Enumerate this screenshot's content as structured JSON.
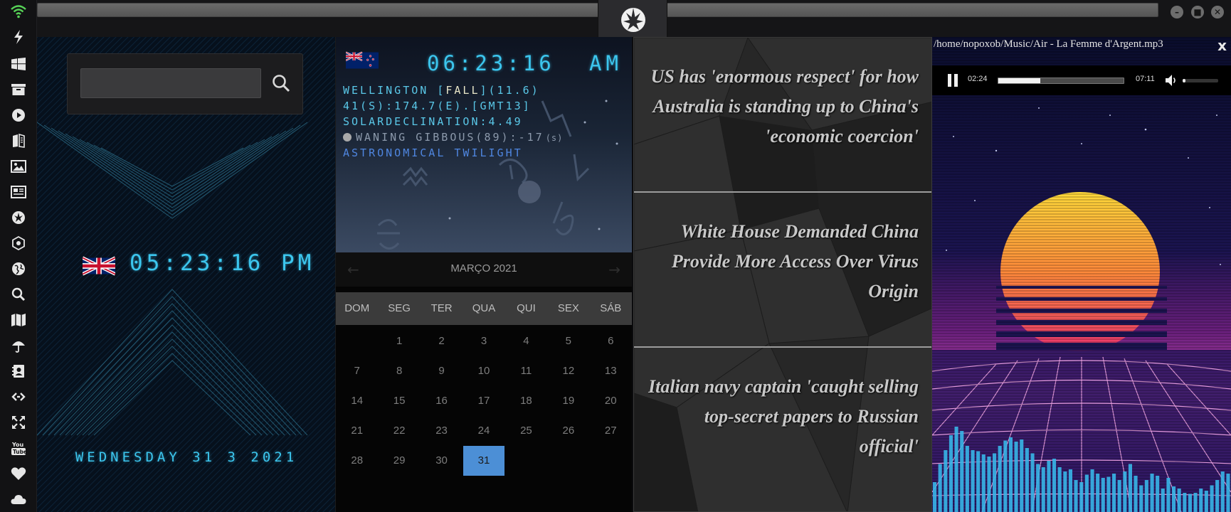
{
  "sidebar": {
    "icons": [
      "wifi-icon",
      "lightning-icon",
      "windows-icon",
      "archive-icon",
      "play-icon",
      "books-icon",
      "image-icon",
      "news-icon",
      "rebel-icon",
      "network-icon",
      "globe-icon",
      "search-icon",
      "map-icon",
      "umbrella-icon",
      "contacts-icon",
      "link-icon",
      "expand-icon",
      "youtube-icon",
      "heart-icon",
      "cloud-icon"
    ]
  },
  "titlebar": {
    "buttons": [
      "minimize",
      "maximize",
      "close"
    ]
  },
  "search": {
    "placeholder": ""
  },
  "uk_clock": {
    "time": "05:23:16 PM"
  },
  "date": {
    "text": "WEDNESDAY 31 3 2021"
  },
  "nz_clock": {
    "time": "06:23:16",
    "ampm": "AM",
    "line1_a": "WELLINGTON [",
    "line1_b": "FALL",
    "line1_c": "](11.6)",
    "line2": "41(S):174.7(E).[GMT13]",
    "line3": "SOLARDECLINATION:4.49",
    "line4_a": "WANING GIBBOUS(89):-17",
    "line4_b": "(s)",
    "line5": "ASTRONOMICAL TWILIGHT"
  },
  "calendar": {
    "month": "MARÇO 2021",
    "prev": "←",
    "next": "→",
    "weekdays": [
      "DOM",
      "SEG",
      "TER",
      "QUA",
      "QUI",
      "SEX",
      "SÁB"
    ],
    "days": [
      "",
      "1",
      "2",
      "3",
      "4",
      "5",
      "6",
      "7",
      "8",
      "9",
      "10",
      "11",
      "12",
      "13",
      "14",
      "15",
      "16",
      "17",
      "18",
      "19",
      "20",
      "21",
      "22",
      "23",
      "24",
      "25",
      "26",
      "27",
      "28",
      "29",
      "30",
      "31"
    ],
    "today": "31"
  },
  "news": {
    "items": [
      "US has 'enormous respect' for how Australia is standing up to China's 'economic coercion'",
      "White House Demanded China Provide More Access Over Virus Origin",
      "Italian navy captain 'caught selling top-secret papers to Russian official'"
    ]
  },
  "player": {
    "path": "/home/nopoxob/Music/Air - La Femme d'Argent.mp3",
    "close": "x",
    "elapsed": "02:24",
    "duration": "07:11",
    "progress": 0.336,
    "volume": 0.08
  },
  "colors": {
    "clock": "#3cc6ee",
    "astro_cyan": "#5ac8e8",
    "astro_blue": "#4f86e0",
    "today": "#4c8fd6"
  },
  "visualizer": {
    "levels": [
      0.28,
      0.45,
      0.58,
      0.72,
      0.8,
      0.76,
      0.62,
      0.58,
      0.57,
      0.54,
      0.52,
      0.55,
      0.62,
      0.67,
      0.7,
      0.66,
      0.68,
      0.6,
      0.55,
      0.45,
      0.42,
      0.48,
      0.5,
      0.42,
      0.38,
      0.4,
      0.3,
      0.28,
      0.35,
      0.4,
      0.36,
      0.32,
      0.33,
      0.36,
      0.3,
      0.38,
      0.45,
      0.34,
      0.25,
      0.3,
      0.36,
      0.34,
      0.22,
      0.32,
      0.24,
      0.22,
      0.18,
      0.17,
      0.18,
      0.22,
      0.2,
      0.25,
      0.3,
      0.38,
      0.36
    ]
  }
}
